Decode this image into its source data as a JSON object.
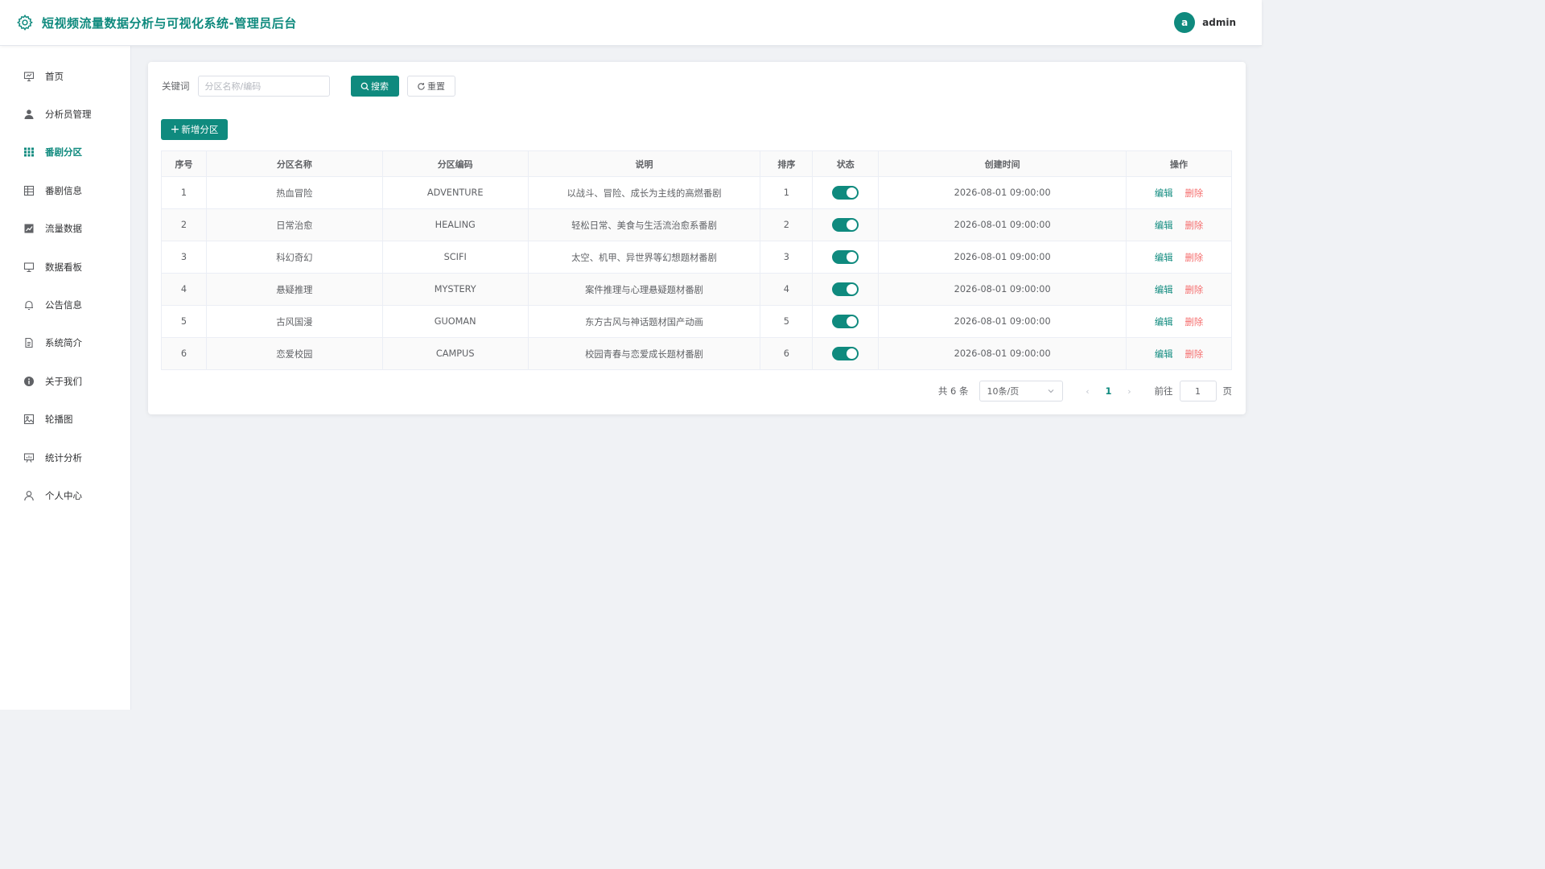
{
  "header": {
    "title": "短视频流量数据分析与可视化系统-管理员后台",
    "avatar_letter": "a",
    "username": "admin",
    "accent_color": "#0f8a7e"
  },
  "sidebar": {
    "items": [
      {
        "label": "首页",
        "icon": "presentation-icon"
      },
      {
        "label": "分析员管理",
        "icon": "user-filled-icon"
      },
      {
        "label": "番剧分区",
        "icon": "grid-icon",
        "active": true
      },
      {
        "label": "番剧信息",
        "icon": "table-icon"
      },
      {
        "label": "流量数据",
        "icon": "chart-icon"
      },
      {
        "label": "数据看板",
        "icon": "monitor-icon"
      },
      {
        "label": "公告信息",
        "icon": "bell-icon"
      },
      {
        "label": "系统简介",
        "icon": "document-icon"
      },
      {
        "label": "关于我们",
        "icon": "info-icon"
      },
      {
        "label": "轮播图",
        "icon": "picture-icon"
      },
      {
        "label": "统计分析",
        "icon": "board-icon"
      },
      {
        "label": "个人中心",
        "icon": "user-icon"
      }
    ]
  },
  "search": {
    "label": "关键词",
    "placeholder": "分区名称/编码",
    "value": "",
    "search_button": "搜索",
    "reset_button": "重置"
  },
  "toolbar": {
    "add_button": "新增分区"
  },
  "table": {
    "columns": [
      "序号",
      "分区名称",
      "分区编码",
      "说明",
      "排序",
      "状态",
      "创建时间",
      "操作"
    ],
    "rows": [
      {
        "idx": "1",
        "name": "热血冒险",
        "code": "ADVENTURE",
        "desc": "以战斗、冒险、成长为主线的高燃番剧",
        "sort": "1",
        "status": true,
        "created": "2026-08-01 09:00:00"
      },
      {
        "idx": "2",
        "name": "日常治愈",
        "code": "HEALING",
        "desc": "轻松日常、美食与生活流治愈系番剧",
        "sort": "2",
        "status": true,
        "created": "2026-08-01 09:00:00"
      },
      {
        "idx": "3",
        "name": "科幻奇幻",
        "code": "SCIFI",
        "desc": "太空、机甲、异世界等幻想题材番剧",
        "sort": "3",
        "status": true,
        "created": "2026-08-01 09:00:00"
      },
      {
        "idx": "4",
        "name": "悬疑推理",
        "code": "MYSTERY",
        "desc": "案件推理与心理悬疑题材番剧",
        "sort": "4",
        "status": true,
        "created": "2026-08-01 09:00:00"
      },
      {
        "idx": "5",
        "name": "古风国漫",
        "code": "GUOMAN",
        "desc": "东方古风与神话题材国产动画",
        "sort": "5",
        "status": true,
        "created": "2026-08-01 09:00:00"
      },
      {
        "idx": "6",
        "name": "恋爱校园",
        "code": "CAMPUS",
        "desc": "校园青春与恋爱成长题材番剧",
        "sort": "6",
        "status": true,
        "created": "2026-08-01 09:00:00"
      }
    ],
    "edit_label": "编辑",
    "delete_label": "删除"
  },
  "pagination": {
    "total_text": "共 6 条",
    "page_size": "10条/页",
    "current_page": "1",
    "goto_label": "前往",
    "goto_value": "1",
    "page_suffix": "页"
  }
}
